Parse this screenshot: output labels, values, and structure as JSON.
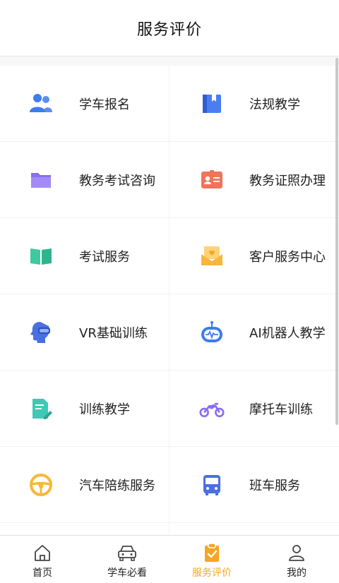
{
  "header": {
    "title": "服务评价"
  },
  "services": [
    {
      "label": "学车报名",
      "icon": "users-icon"
    },
    {
      "label": "法规教学",
      "icon": "book-icon"
    },
    {
      "label": "教务考试咨询",
      "icon": "folder-icon"
    },
    {
      "label": "教务证照办理",
      "icon": "id-card-icon"
    },
    {
      "label": "考试服务",
      "icon": "open-book-icon"
    },
    {
      "label": "客户服务中心",
      "icon": "mail-heart-icon"
    },
    {
      "label": "VR基础训练",
      "icon": "vr-head-icon"
    },
    {
      "label": "AI机器人教学",
      "icon": "robot-icon"
    },
    {
      "label": "训练教学",
      "icon": "document-edit-icon"
    },
    {
      "label": "摩托车训练",
      "icon": "motorcycle-icon"
    },
    {
      "label": "汽车陪练服务",
      "icon": "steering-wheel-icon"
    },
    {
      "label": "班车服务",
      "icon": "bus-icon"
    }
  ],
  "tabbar": {
    "active": 2,
    "accent": "#f5a623",
    "items": [
      {
        "label": "首页",
        "icon": "home-icon"
      },
      {
        "label": "学车必看",
        "icon": "car-icon"
      },
      {
        "label": "服务评价",
        "icon": "clipboard-check-icon"
      },
      {
        "label": "我的",
        "icon": "user-icon"
      }
    ]
  }
}
